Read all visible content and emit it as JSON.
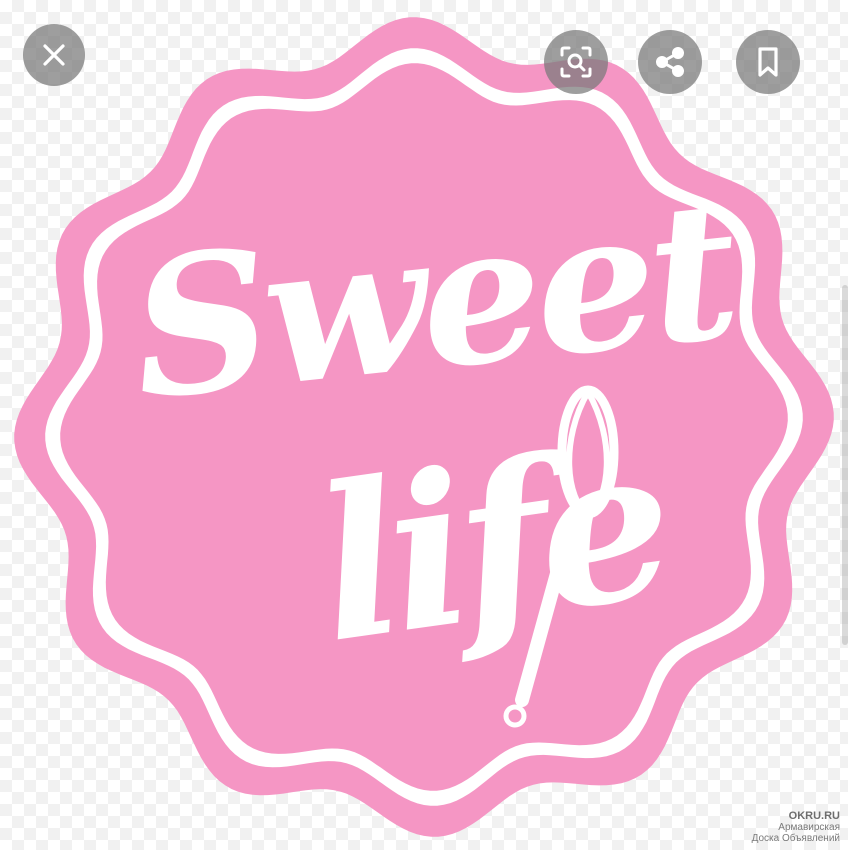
{
  "logo": {
    "line1": "Sweet",
    "line2": "life",
    "colors": {
      "badge": "#f596c4",
      "badge_dark": "#ec85b7",
      "ring": "#ffffff",
      "text": "#ffffff"
    }
  },
  "controls": {
    "close_icon": "close-icon",
    "lens_icon": "lens-icon",
    "share_icon": "share-icon",
    "bookmark_icon": "bookmark-icon",
    "button_bg": "#7f7f7f"
  },
  "watermark": {
    "site": "OKRU.RU",
    "line1": "Армавирская",
    "line2": "Доска Объявлений"
  }
}
